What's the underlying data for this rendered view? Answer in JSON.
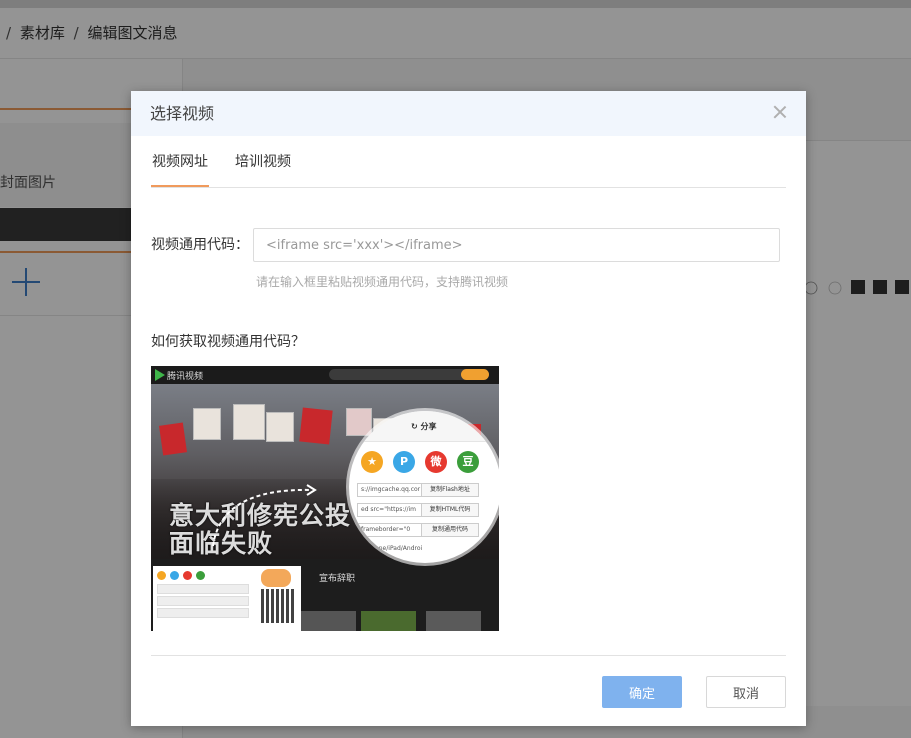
{
  "background": {
    "breadcrumb": {
      "separator": "/",
      "items": [
        "素材库",
        "编辑图文消息"
      ]
    },
    "cover_label": "封面图片"
  },
  "modal": {
    "title": "选择视频",
    "tabs": [
      {
        "label": "视频网址",
        "active": true
      },
      {
        "label": "培训视频",
        "active": false
      }
    ],
    "code_field": {
      "label": "视频通用代码：",
      "value": "",
      "placeholder": "<iframe src='xxx'></iframe>",
      "hint": "请在输入框里粘贴视频通用代码，支持腾讯视频"
    },
    "howto_label": "如何获取视频通用代码？",
    "illustration": {
      "logo_text": "腾讯视频",
      "caption_line1": "意大利修宪公投",
      "caption_line2": "面临失败",
      "news_title": "宣布辞职",
      "share_label": "分享",
      "share_icons": [
        {
          "glyph": "★",
          "color": "#f5a623"
        },
        {
          "glyph": "P",
          "color": "#3aa7e6"
        },
        {
          "glyph": "微",
          "color": "#e6392f"
        },
        {
          "glyph": "豆",
          "color": "#3b9e3b"
        }
      ],
      "rows": [
        {
          "url": "s://imgcache.qq.cor",
          "button": "复制Flash地址"
        },
        {
          "url": "ed src=\"https://im",
          "button": "复制HTML代码"
        },
        {
          "url": "frameborder=\"0",
          "button": "复制通用代码"
        },
        {
          "url": "于iPhone/iPad/Androi",
          "button": ""
        }
      ]
    },
    "footer": {
      "confirm_label": "确定",
      "cancel_label": "取消"
    }
  },
  "colors": {
    "accent_tab": "#f09a5c",
    "primary_button": "#7fb2ee",
    "header_bg": "#f1f6fd"
  }
}
